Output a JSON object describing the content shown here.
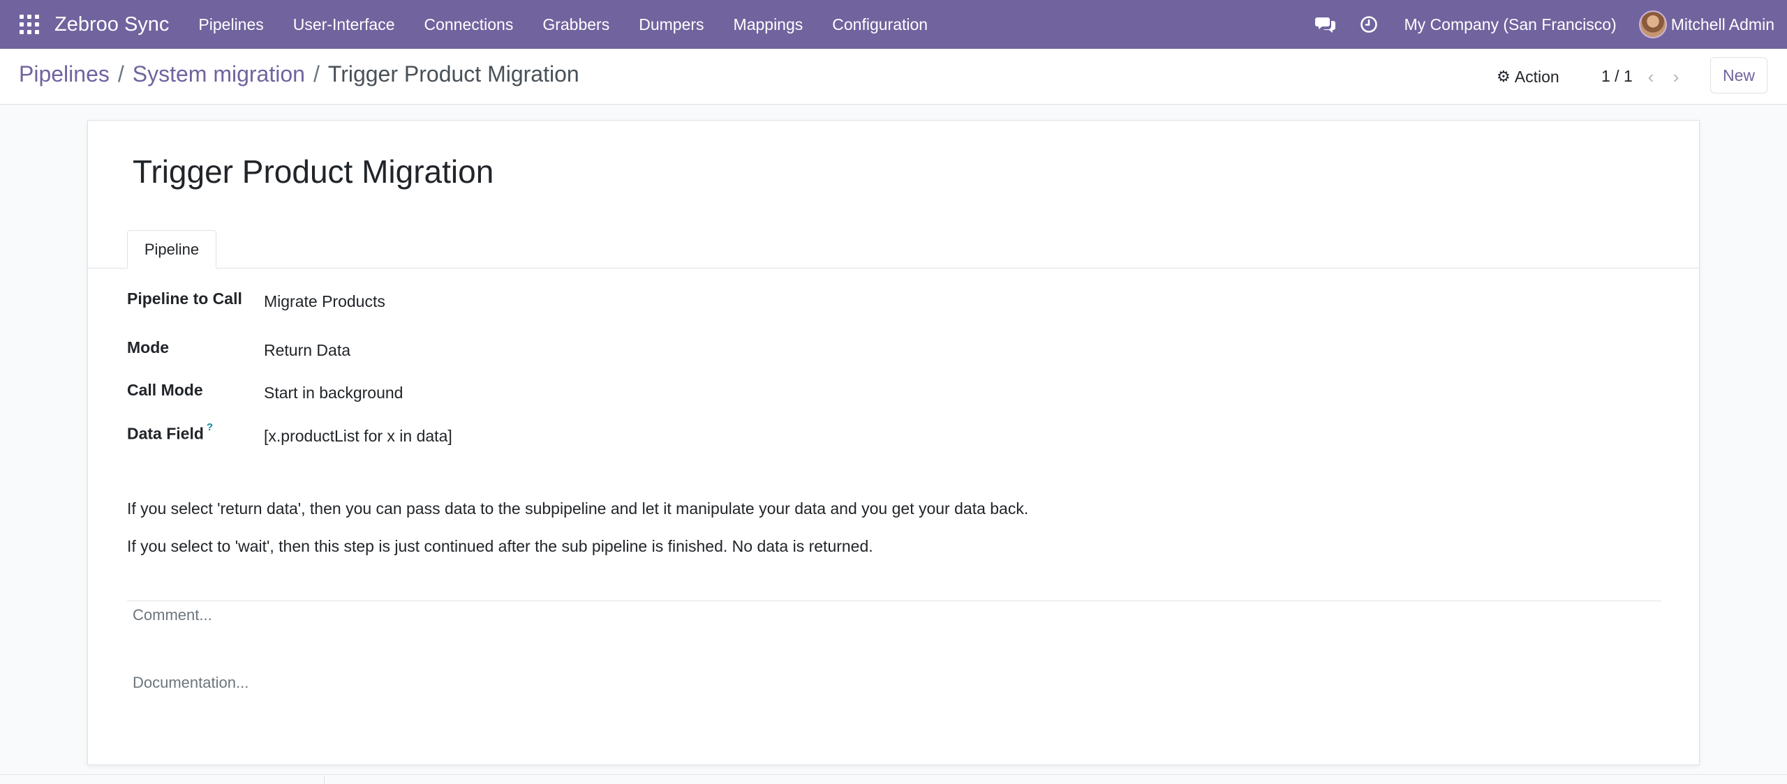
{
  "navbar": {
    "app_name": "Zebroo Sync",
    "menu": [
      "Pipelines",
      "User-Interface",
      "Connections",
      "Grabbers",
      "Dumpers",
      "Mappings",
      "Configuration"
    ],
    "company": "My Company (San Francisco)",
    "user": "Mitchell Admin",
    "colors": {
      "background": "#71639e",
      "text": "#ffffff"
    }
  },
  "breadcrumb": {
    "items": [
      "Pipelines",
      "System migration"
    ],
    "current": "Trigger Product Migration",
    "separator": "/"
  },
  "control": {
    "action_label": "Action",
    "pager": "1 / 1",
    "new_label": "New"
  },
  "form": {
    "title": "Trigger Product Migration",
    "tabs": [
      "Pipeline"
    ],
    "fields": [
      {
        "label": "Pipeline to Call",
        "value": "Migrate Products"
      },
      {
        "label": "Mode",
        "value": "Return Data"
      },
      {
        "label": "Call Mode",
        "value": "Start in background"
      },
      {
        "label": "Data Field",
        "help_marker": "?",
        "value": "[x.productList for x in data]"
      }
    ],
    "help_lines": [
      "If you select 'return data', then you can pass data to the subpipeline and let it manipulate your data and you get your data back.",
      "If you select to 'wait', then this step is just continued after the sub pipeline is finished. No data is returned."
    ],
    "comment_placeholder": "Comment...",
    "documentation_placeholder": "Documentation..."
  },
  "icons": {
    "apps": "apps-grid-icon",
    "chat": "chat-icon",
    "activity": "clock-icon",
    "action": "gear-icon",
    "prev": "chevron-left-icon",
    "next": "chevron-right-icon"
  }
}
